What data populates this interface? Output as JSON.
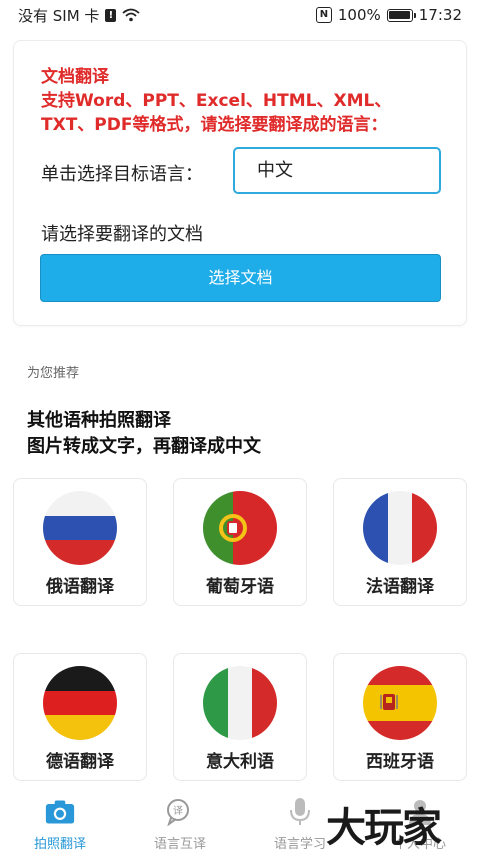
{
  "status_bar": {
    "carrier": "没有 SIM 卡",
    "sim_glyph": "!",
    "nfc_glyph": "N",
    "battery": "100%",
    "battery_level": 1.0,
    "time": "17:32"
  },
  "doc_card": {
    "title": "文档翻译",
    "formats_line1": "支持Word、PPT、Excel、HTML、XML、",
    "formats_line2": "TXT、PDF等格式，请选择要翻译成的语言：",
    "target_label": "单击选择目标语言：",
    "target_value": "中文",
    "choose_doc_label": "请选择要翻译的文档",
    "choose_button": "选择文档"
  },
  "recommend": {
    "section_label": "为您推荐",
    "headline1": "其他语种拍照翻译",
    "headline2": "图片转成文字，再翻译成中文"
  },
  "languages": [
    {
      "label": "俄语翻译",
      "flag": "russia-flag-icon"
    },
    {
      "label": "葡萄牙语",
      "flag": "portugal-flag-icon"
    },
    {
      "label": "法语翻译",
      "flag": "france-flag-icon"
    },
    {
      "label": "德语翻译",
      "flag": "germany-flag-icon"
    },
    {
      "label": "意大利语",
      "flag": "italy-flag-icon"
    },
    {
      "label": "西班牙语",
      "flag": "spain-flag-icon"
    }
  ],
  "tabs": [
    {
      "label": "拍照翻译",
      "icon": "camera-icon",
      "active": true
    },
    {
      "label": "语言互译",
      "icon": "translate-bubble-icon",
      "active": false
    },
    {
      "label": "语言学习",
      "icon": "microphone-icon",
      "active": false
    },
    {
      "label": "个人中心",
      "icon": "person-icon",
      "active": false
    }
  ],
  "watermark": "大玩家",
  "colors": {
    "accent": "#1fade9",
    "title_red": "#e02b2b",
    "tab_active": "#2a98d8",
    "tab_inactive": "#999999"
  }
}
